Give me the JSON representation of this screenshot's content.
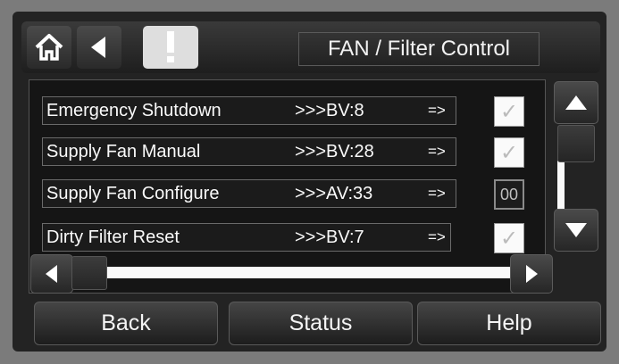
{
  "header": {
    "title": "FAN / Filter Control",
    "icons": {
      "home": "home-icon",
      "back": "back-arrow-icon",
      "alert": "alert-icon"
    }
  },
  "points": [
    {
      "label": "Emergency Shutdown",
      "ref": ">>>BV:8",
      "arrow": "=>",
      "control": "checkbox",
      "checked": true
    },
    {
      "label": "Supply Fan Manual",
      "ref": ">>>BV:28",
      "arrow": "=>",
      "control": "checkbox",
      "checked": true
    },
    {
      "label": "Supply Fan Configure",
      "ref": ">>>AV:33",
      "arrow": "=>",
      "control": "value",
      "value": "00"
    },
    {
      "label": "Dirty Filter  Reset",
      "ref": ">>>BV:7",
      "arrow": "=>",
      "control": "checkbox",
      "checked": true
    }
  ],
  "footer": {
    "back": "Back",
    "status": "Status",
    "help": "Help"
  },
  "colors": {
    "background": "#7b7b7b",
    "panel": "#232323",
    "text": "#fafafa",
    "accent": "#d8d8d8"
  }
}
